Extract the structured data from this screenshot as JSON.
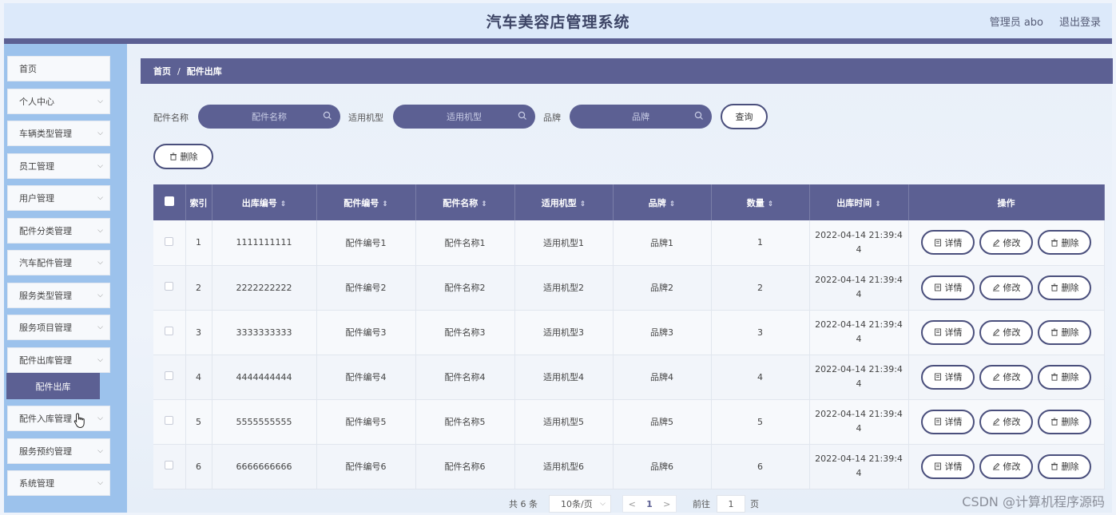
{
  "header": {
    "title": "汽车美容店管理系统",
    "user": "管理员 abo",
    "logout": "退出登录"
  },
  "sidebar": {
    "items": [
      {
        "label": "首页",
        "chevron": false
      },
      {
        "label": "个人中心",
        "chevron": true
      },
      {
        "label": "车辆类型管理",
        "chevron": true
      },
      {
        "label": "员工管理",
        "chevron": true
      },
      {
        "label": "用户管理",
        "chevron": true
      },
      {
        "label": "配件分类管理",
        "chevron": true
      },
      {
        "label": "汽车配件管理",
        "chevron": true
      },
      {
        "label": "服务类型管理",
        "chevron": true
      },
      {
        "label": "服务项目管理",
        "chevron": true
      },
      {
        "label": "配件出库管理",
        "chevron": true
      },
      {
        "label": "配件入库管理",
        "chevron": true
      },
      {
        "label": "服务预约管理",
        "chevron": true
      },
      {
        "label": "系统管理",
        "chevron": true
      }
    ],
    "active_sub": "配件出库"
  },
  "breadcrumb": {
    "home": "首页",
    "sep": "/",
    "current": "配件出库"
  },
  "search": {
    "part_name_label": "配件名称",
    "part_name_placeholder": "配件名称",
    "model_label": "适用机型",
    "model_placeholder": "适用机型",
    "brand_label": "品牌",
    "brand_placeholder": "品牌",
    "query_button": "查询"
  },
  "toolbar": {
    "delete_button": "删除"
  },
  "table": {
    "headers": [
      "索引",
      "出库编号",
      "配件编号",
      "配件名称",
      "适用机型",
      "品牌",
      "数量",
      "出库时间",
      "操作"
    ],
    "rows": [
      {
        "index": "1",
        "out_no": "1111111111",
        "part_no": "配件编号1",
        "part_name": "配件名称1",
        "model": "适用机型1",
        "brand": "品牌1",
        "qty": "1",
        "time": "2022-04-14 21:39:44"
      },
      {
        "index": "2",
        "out_no": "2222222222",
        "part_no": "配件编号2",
        "part_name": "配件名称2",
        "model": "适用机型2",
        "brand": "品牌2",
        "qty": "2",
        "time": "2022-04-14 21:39:44"
      },
      {
        "index": "3",
        "out_no": "3333333333",
        "part_no": "配件编号3",
        "part_name": "配件名称3",
        "model": "适用机型3",
        "brand": "品牌3",
        "qty": "3",
        "time": "2022-04-14 21:39:44"
      },
      {
        "index": "4",
        "out_no": "4444444444",
        "part_no": "配件编号4",
        "part_name": "配件名称4",
        "model": "适用机型4",
        "brand": "品牌4",
        "qty": "4",
        "time": "2022-04-14 21:39:44"
      },
      {
        "index": "5",
        "out_no": "5555555555",
        "part_no": "配件编号5",
        "part_name": "配件名称5",
        "model": "适用机型5",
        "brand": "品牌5",
        "qty": "5",
        "time": "2022-04-14 21:39:44"
      },
      {
        "index": "6",
        "out_no": "6666666666",
        "part_no": "配件编号6",
        "part_name": "配件名称6",
        "model": "适用机型6",
        "brand": "品牌6",
        "qty": "6",
        "time": "2022-04-14 21:39:44"
      }
    ],
    "actions": {
      "detail": "详情",
      "edit": "修改",
      "delete": "删除"
    }
  },
  "pagination": {
    "total": "共 6 条",
    "page_size": "10条/页",
    "prev": "<",
    "current": "1",
    "next": ">",
    "goto": "前往",
    "goto_value": "1",
    "page_unit": "页"
  },
  "watermark": "CSDN @计算机程序源码",
  "colors": {
    "primary": "#5c6093",
    "sidebar": "#9cc2ec",
    "header": "#dce9fa"
  }
}
